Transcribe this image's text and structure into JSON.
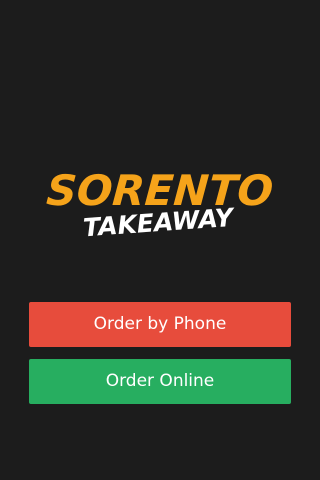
{
  "logo": {
    "title": "SORENTO",
    "subtitle": "TAKEAWAY"
  },
  "buttons": {
    "phone_label": "Order by Phone",
    "online_label": "Order Online"
  },
  "colors": {
    "background": "#1c1c1c",
    "logo_title": "#f5a31a",
    "logo_subtitle": "#ffffff",
    "phone_button": "#e74c3c",
    "online_button": "#27ae60"
  }
}
